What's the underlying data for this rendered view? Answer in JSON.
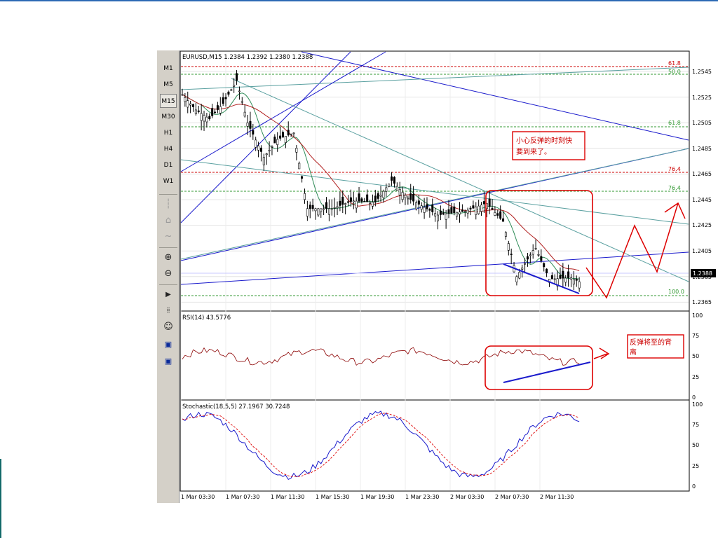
{
  "chart": {
    "header": "EURUSD,M15  1.2384 1.2392 1.2380 1.2388",
    "price_ticks": [
      "1.2545",
      "1.2525",
      "1.2505",
      "1.2485",
      "1.2465",
      "1.2445",
      "1.2425",
      "1.2405",
      "1.2385",
      "1.2365"
    ],
    "current_price": "1.2388",
    "fibo_labels": [
      {
        "label": "61.8",
        "color": "#cc0000"
      },
      {
        "label": "50.0",
        "color": "#339933"
      },
      {
        "label": "61.8",
        "color": "#339933"
      },
      {
        "label": "76.4",
        "color": "#cc0000"
      },
      {
        "label": "76.4",
        "color": "#339933"
      },
      {
        "label": "100.0",
        "color": "#339933"
      }
    ],
    "note_main": [
      "小心反弹的时刻快",
      "要到来了。"
    ],
    "note_rsi": [
      "反弹将至的背",
      "离"
    ]
  },
  "rsi": {
    "header": "RSI(14)  43.5776",
    "ticks": [
      "100",
      "75",
      "50",
      "25",
      "0"
    ]
  },
  "stoch": {
    "header": "Stochastic(18,5,5)  27.1967  30.7248",
    "ticks": [
      "100",
      "75",
      "50",
      "25",
      "0"
    ]
  },
  "time_labels": [
    "1 Mar 03:30",
    "1 Mar 07:30",
    "1 Mar 11:30",
    "1 Mar 15:30",
    "1 Mar 19:30",
    "1 Mar 23:30",
    "2 Mar 03:30",
    "2 Mar 07:30",
    "2 Mar 11:30"
  ],
  "toolbar": {
    "timeframes": [
      "M1",
      "M5",
      "M15",
      "M30",
      "H1",
      "H4",
      "D1",
      "W1"
    ],
    "active_timeframe": "M15"
  },
  "colors": {
    "candle": "#000000",
    "ma_green": "#2e8b57",
    "ma_red": "#b22222",
    "trend_blue": "#1a1acc",
    "trend_teal": "#5aa0a0",
    "annot_red": "#dd0000",
    "rsi_line": "#8b0000",
    "stoch_main": "#1a1acc",
    "stoch_signal": "#dd0000"
  }
}
